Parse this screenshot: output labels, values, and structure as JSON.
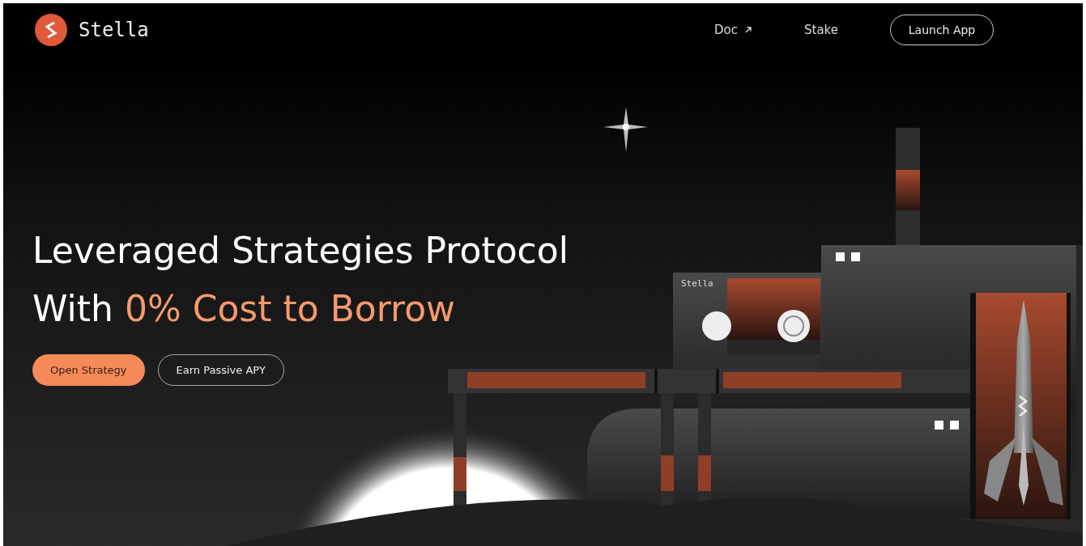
{
  "header": {
    "brand": "Stella",
    "nav": [
      {
        "label": "Doc",
        "external": true
      },
      {
        "label": "Stake",
        "external": false
      }
    ],
    "cta": "Launch App"
  },
  "hero": {
    "title_line_1": "Leveraged Strategies Protocol",
    "title_line_2_prefix": "With ",
    "title_line_2_highlight": "0% Cost to Borrow",
    "buttons": [
      {
        "label": "Open Strategy",
        "kind": "primary"
      },
      {
        "label": "Earn Passive APY",
        "kind": "outline"
      }
    ]
  },
  "illustration": {
    "sign": "Stella"
  }
}
